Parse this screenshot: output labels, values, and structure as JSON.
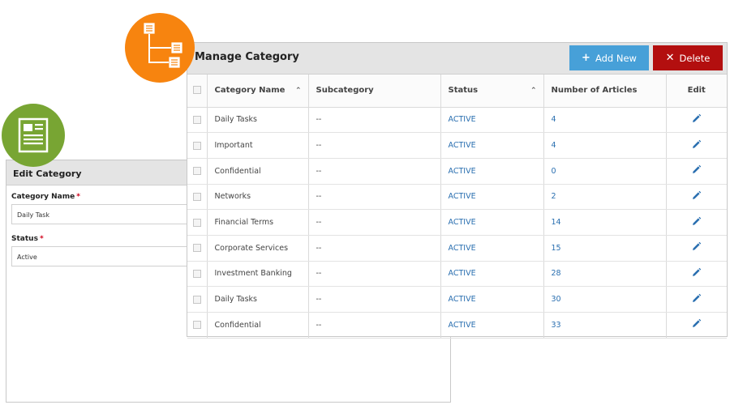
{
  "edit_panel": {
    "title": "Edit Category",
    "fields": [
      {
        "label": "Category Name",
        "required_mark": "*",
        "value": "Daily Task"
      },
      {
        "label": "Status",
        "required_mark": "*",
        "value": "Active"
      }
    ],
    "icon": "document-icon",
    "icon_color": "#78a533"
  },
  "manage_panel": {
    "title": "Manage Category",
    "icon": "hierarchy-icon",
    "icon_color": "#f7840f",
    "buttons": {
      "add_new": {
        "glyph": "+",
        "label": "Add New",
        "color": "#47a0d8"
      },
      "delete": {
        "glyph": "✕",
        "label": "Delete",
        "color": "#b30f0f"
      }
    },
    "columns": [
      "Category Name",
      "Subcategory",
      "Status",
      "Number of Articles",
      "Edit"
    ],
    "rows": [
      {
        "name": "Daily Tasks",
        "subcategory": "--",
        "status": "ACTIVE",
        "articles": "4"
      },
      {
        "name": "Important",
        "subcategory": "--",
        "status": "ACTIVE",
        "articles": "4"
      },
      {
        "name": "Confidential",
        "subcategory": "--",
        "status": "ACTIVE",
        "articles": "0"
      },
      {
        "name": "Networks",
        "subcategory": "--",
        "status": "ACTIVE",
        "articles": "2"
      },
      {
        "name": "Financial Terms",
        "subcategory": "--",
        "status": "ACTIVE",
        "articles": "14"
      },
      {
        "name": "Corporate Services",
        "subcategory": "--",
        "status": "ACTIVE",
        "articles": "15"
      },
      {
        "name": "Investment Banking",
        "subcategory": "--",
        "status": "ACTIVE",
        "articles": "28"
      },
      {
        "name": "Daily Tasks",
        "subcategory": "--",
        "status": "ACTIVE",
        "articles": "30"
      },
      {
        "name": "Confidential",
        "subcategory": "--",
        "status": "ACTIVE",
        "articles": "33"
      }
    ]
  },
  "colors": {
    "link": "#2a6fb0",
    "header_bg": "#e4e4e4",
    "required": "#d0021b"
  }
}
